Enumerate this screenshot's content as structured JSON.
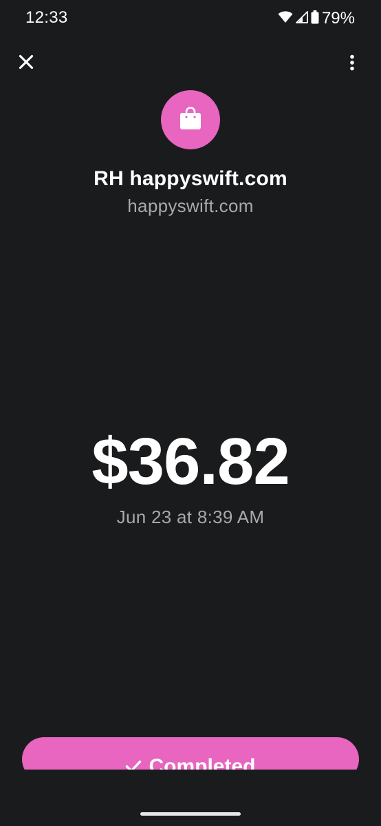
{
  "status_bar": {
    "time": "12:33",
    "battery_percent": "79%",
    "icons": [
      "wifi-icon",
      "cell-signal-icon",
      "battery-icon"
    ]
  },
  "header": {
    "close_icon": "close-icon",
    "more_icon": "more-vertical-icon"
  },
  "merchant": {
    "icon": "shopping-bag-icon",
    "name": "RH happyswift.com",
    "domain": "happyswift.com"
  },
  "transaction": {
    "amount": "$36.82",
    "date": "Jun 23 at 8:39 AM"
  },
  "action": {
    "status_label": "Completed",
    "icon": "checkmark-icon"
  },
  "colors": {
    "accent": "#e865c0",
    "background": "#1a1b1d",
    "secondary_text": "#a9a9ac"
  }
}
